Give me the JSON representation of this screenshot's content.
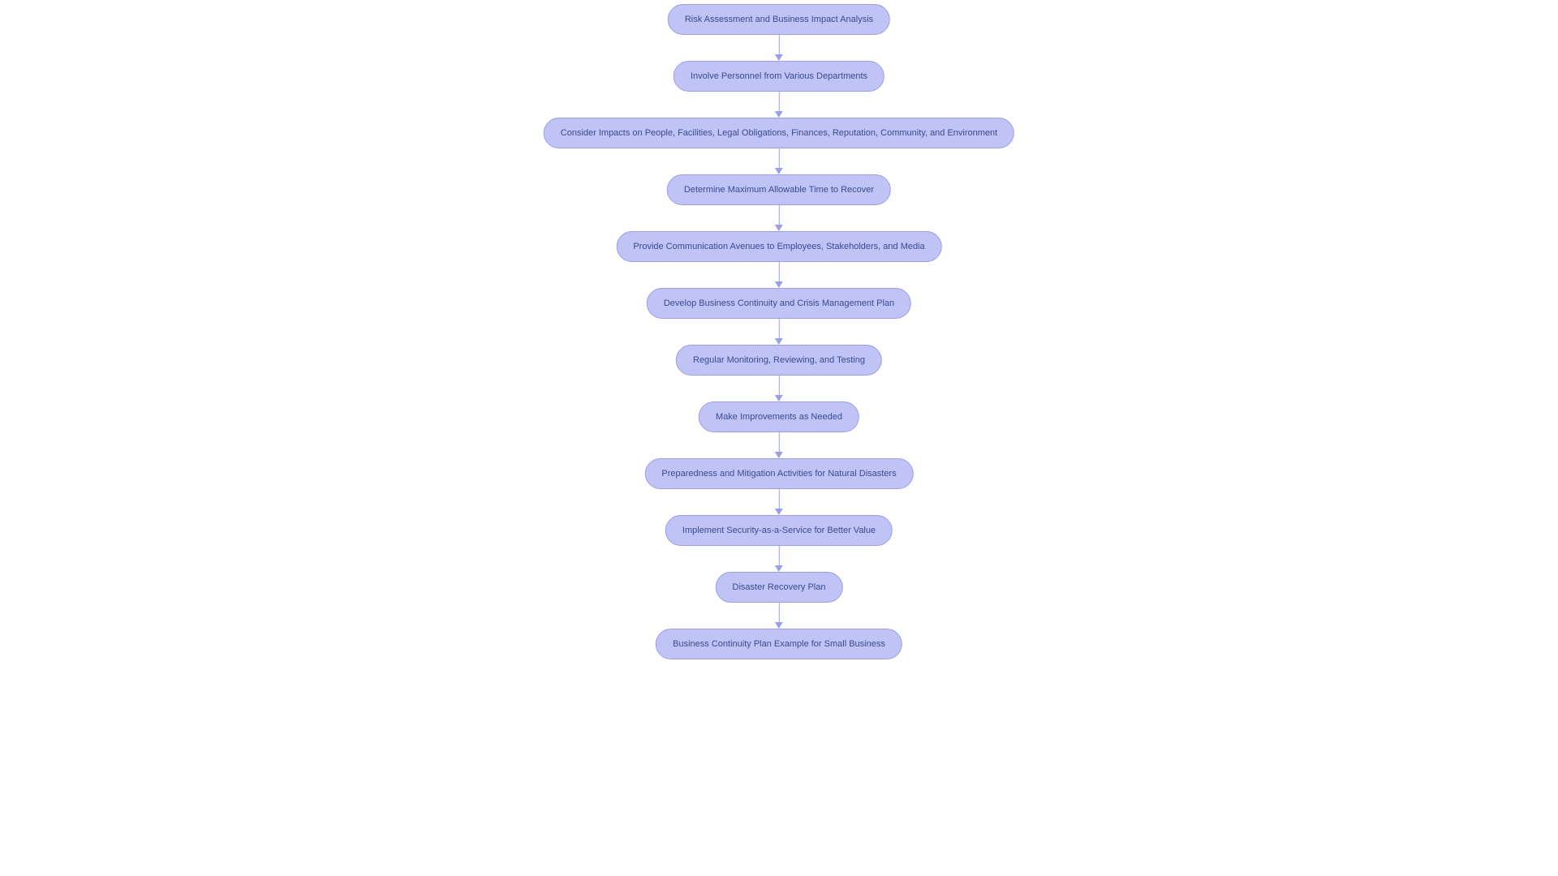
{
  "flowchart": {
    "nodes": [
      {
        "label": "Risk Assessment and Business Impact Analysis"
      },
      {
        "label": "Involve Personnel from Various Departments"
      },
      {
        "label": "Consider Impacts on People, Facilities, Legal Obligations, Finances, Reputation, Community, and Environment"
      },
      {
        "label": "Determine Maximum Allowable Time to Recover"
      },
      {
        "label": "Provide Communication Avenues to Employees, Stakeholders, and Media"
      },
      {
        "label": "Develop Business Continuity and Crisis Management Plan"
      },
      {
        "label": "Regular Monitoring, Reviewing, and Testing"
      },
      {
        "label": "Make Improvements as Needed"
      },
      {
        "label": "Preparedness and Mitigation Activities for Natural Disasters"
      },
      {
        "label": "Implement Security-as-a-Service for Better Value"
      },
      {
        "label": "Disaster Recovery Plan"
      },
      {
        "label": "Business Continuity Plan Example for Small Business"
      }
    ],
    "colors": {
      "node_fill": "#bfc3f5",
      "node_border": "#9b9ee8",
      "node_text": "#3b4a8f",
      "arrow": "#9b9ee8"
    }
  }
}
